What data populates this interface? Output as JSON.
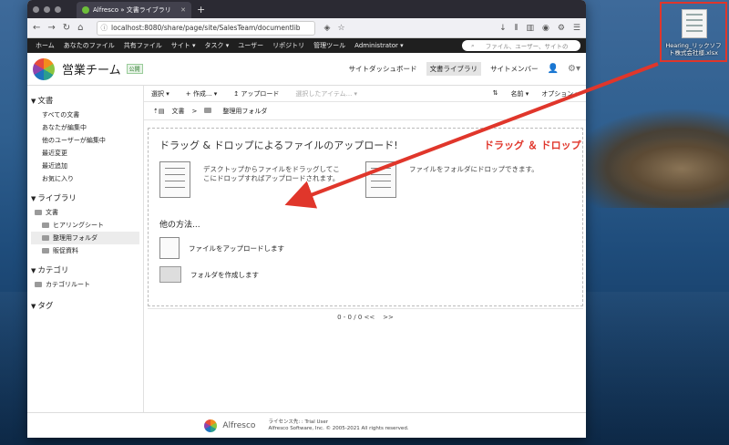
{
  "browser": {
    "tab_title": "Alfresco » 文書ライブラリ",
    "url": "localhost:8080/share/page/site/SalesTeam/documentlib"
  },
  "topnav": {
    "items": [
      "ホーム",
      "あなたのファイル",
      "共有ファイル",
      "サイト ▾",
      "タスク ▾",
      "ユーザー",
      "リポジトリ",
      "管理ツール",
      "Administrator ▾"
    ],
    "search_placeholder": "ファイル、ユーザー、サイトの"
  },
  "site": {
    "name": "営業チーム",
    "visibility": "公開",
    "links": [
      "サイトダッシュボード",
      "文書ライブラリ",
      "サイトメンバー"
    ]
  },
  "sidebar": {
    "documents_header": "文書",
    "documents": [
      "すべての文書",
      "あなたが編集中",
      "他のユーザーが編集中",
      "最近変更",
      "最近追加",
      "お気に入り"
    ],
    "library_header": "ライブラリ",
    "library_root": "文書",
    "library_folders": [
      "ヒアリングシート",
      "整理用フォルダ",
      "販促資料"
    ],
    "category_header": "カテゴリ",
    "category_root": "カテゴリルート",
    "tags_header": "タグ"
  },
  "toolbar": {
    "select": "選択 ▾",
    "create": "+ 作成... ▾",
    "upload": "↥ アップロード",
    "selected_items": "選択したアイテム... ▾",
    "name_sort": "名前 ▾",
    "options": "オプション ▾"
  },
  "breadcrumb": {
    "root": "文書",
    "sep": ">",
    "current": "整理用フォルダ"
  },
  "dropzone": {
    "title": "ドラッグ & ドロップによるファイルのアップロード!",
    "desktop_text": "デスクトップからファイルをドラッグしてここにドロップすればアップロードされます。",
    "folder_text": "ファイルをフォルダにドロップできます。",
    "other_title": "他の方法...",
    "upload_option": "ファイルをアップロードします",
    "create_folder_option": "フォルダを作成します"
  },
  "pager": {
    "text": "0 - 0 / 0 <<",
    "next": ">>"
  },
  "footer": {
    "brand": "Alfresco",
    "license": "ライセンス先: : Trial User",
    "copyright": "Alfresco Software, Inc. © 2005-2021 All rights reserved."
  },
  "desktop": {
    "file_name": "Hearing_リックソフト株式会社様.xlsx",
    "annotation": "ドラッグ ＆ ドロップ",
    "annotation_color": "#e0362b"
  }
}
